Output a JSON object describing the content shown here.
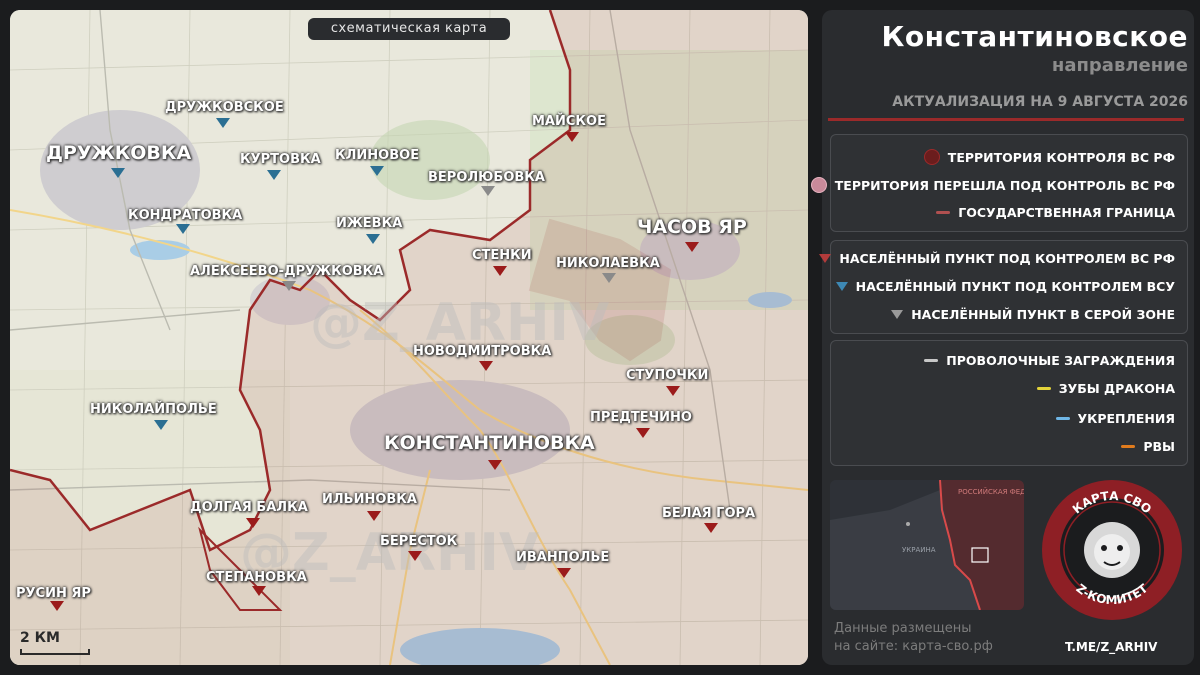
{
  "map_title": "схематическая карта",
  "scale_label": "2 КМ",
  "panel": {
    "title": "Константиновское",
    "subtitle": "направление",
    "date": "АКТУАЛИЗАЦИЯ НА 9 АВГУСТА 2026"
  },
  "legend_territory": [
    {
      "label": "ТЕРРИТОРИЯ КОНТРОЛЯ ВС РФ",
      "color": "#6b1d1d"
    },
    {
      "label": "ТЕРРИТОРИЯ ПЕРЕШЛА ПОД КОНТРОЛЬ ВС РФ",
      "color": "#c98a9a"
    },
    {
      "label": "ГОСУДАРСТВЕННАЯ ГРАНИЦА",
      "color": "#b05050"
    }
  ],
  "legend_settlements": [
    {
      "label": "НАСЕЛЁННЫЙ ПУНКТ ПОД КОНТРОЛЕМ ВС РФ",
      "color": "#b23b3b"
    },
    {
      "label": "НАСЕЛЁННЫЙ ПУНКТ ПОД КОНТРОЛЕМ ВСУ",
      "color": "#3d88b4"
    },
    {
      "label": "НАСЕЛЁННЫЙ ПУНКТ В СЕРОЙ ЗОНЕ",
      "color": "#9a9a9a"
    }
  ],
  "legend_defense": [
    {
      "label": "ПРОВОЛОЧНЫЕ ЗАГРАЖДЕНИЯ",
      "color": "#c8c8c8"
    },
    {
      "label": "ЗУБЫ ДРАКОНА",
      "color": "#e3d33a"
    },
    {
      "label": "УКРЕПЛЕНИЯ",
      "color": "#6fb6e6"
    },
    {
      "label": "РВЫ",
      "color": "#e07b1d"
    }
  ],
  "minimap": {
    "russia": "РОССИЙСКАЯ ФЕДЕРАЦИЯ",
    "ukraine": "УКРАИНА"
  },
  "site_text": [
    "Данные размещены",
    "на сайте: карта-сво.рф"
  ],
  "emblem": {
    "top": "КАРТА СВО",
    "bottom": "Z-КОМИТЕТ"
  },
  "telegram": "T.ME/Z_ARHIV",
  "places": [
    {
      "name": "ДРУЖКОВКА",
      "status": "ukr",
      "big": true
    },
    {
      "name": "ДРУЖКОВСКОЕ",
      "status": "ukr"
    },
    {
      "name": "КУРТОВКА",
      "status": "ukr"
    },
    {
      "name": "КЛИНОВОЕ",
      "status": "ukr"
    },
    {
      "name": "КОНДРАТОВКА",
      "status": "ukr"
    },
    {
      "name": "МАЙСКОЕ",
      "status": "rf"
    },
    {
      "name": "ВЕРОЛЮБОВКА",
      "status": "gray"
    },
    {
      "name": "ЧАСОВ ЯР",
      "status": "rf",
      "big": true
    },
    {
      "name": "ИЖЕВКА",
      "status": "ukr"
    },
    {
      "name": "СТЕНКИ",
      "status": "rf"
    },
    {
      "name": "НИКОЛАЕВКА",
      "status": "gray"
    },
    {
      "name": "АЛЕКСЕЕВО-ДРУЖКОВКА",
      "status": "gray"
    },
    {
      "name": "НОВОДМИТРОВКА",
      "status": "rf"
    },
    {
      "name": "СТУПОЧКИ",
      "status": "rf"
    },
    {
      "name": "НИКОЛАЙПОЛЬЕ",
      "status": "ukr"
    },
    {
      "name": "ПРЕДТЕЧИНО",
      "status": "rf"
    },
    {
      "name": "КОНСТАНТИНОВКА",
      "status": "rf",
      "big": true
    },
    {
      "name": "ИЛЬИНОВКА",
      "status": "rf"
    },
    {
      "name": "ДОЛГАЯ БАЛКА",
      "status": "rf"
    },
    {
      "name": "БЕЛАЯ ГОРА",
      "status": "rf"
    },
    {
      "name": "БЕРЕСТОК",
      "status": "rf"
    },
    {
      "name": "ИВАНПОЛЬЕ",
      "status": "rf"
    },
    {
      "name": "СТЕПАНОВКА",
      "status": "rf"
    },
    {
      "name": "РУСИН ЯР",
      "status": "rf"
    }
  ]
}
